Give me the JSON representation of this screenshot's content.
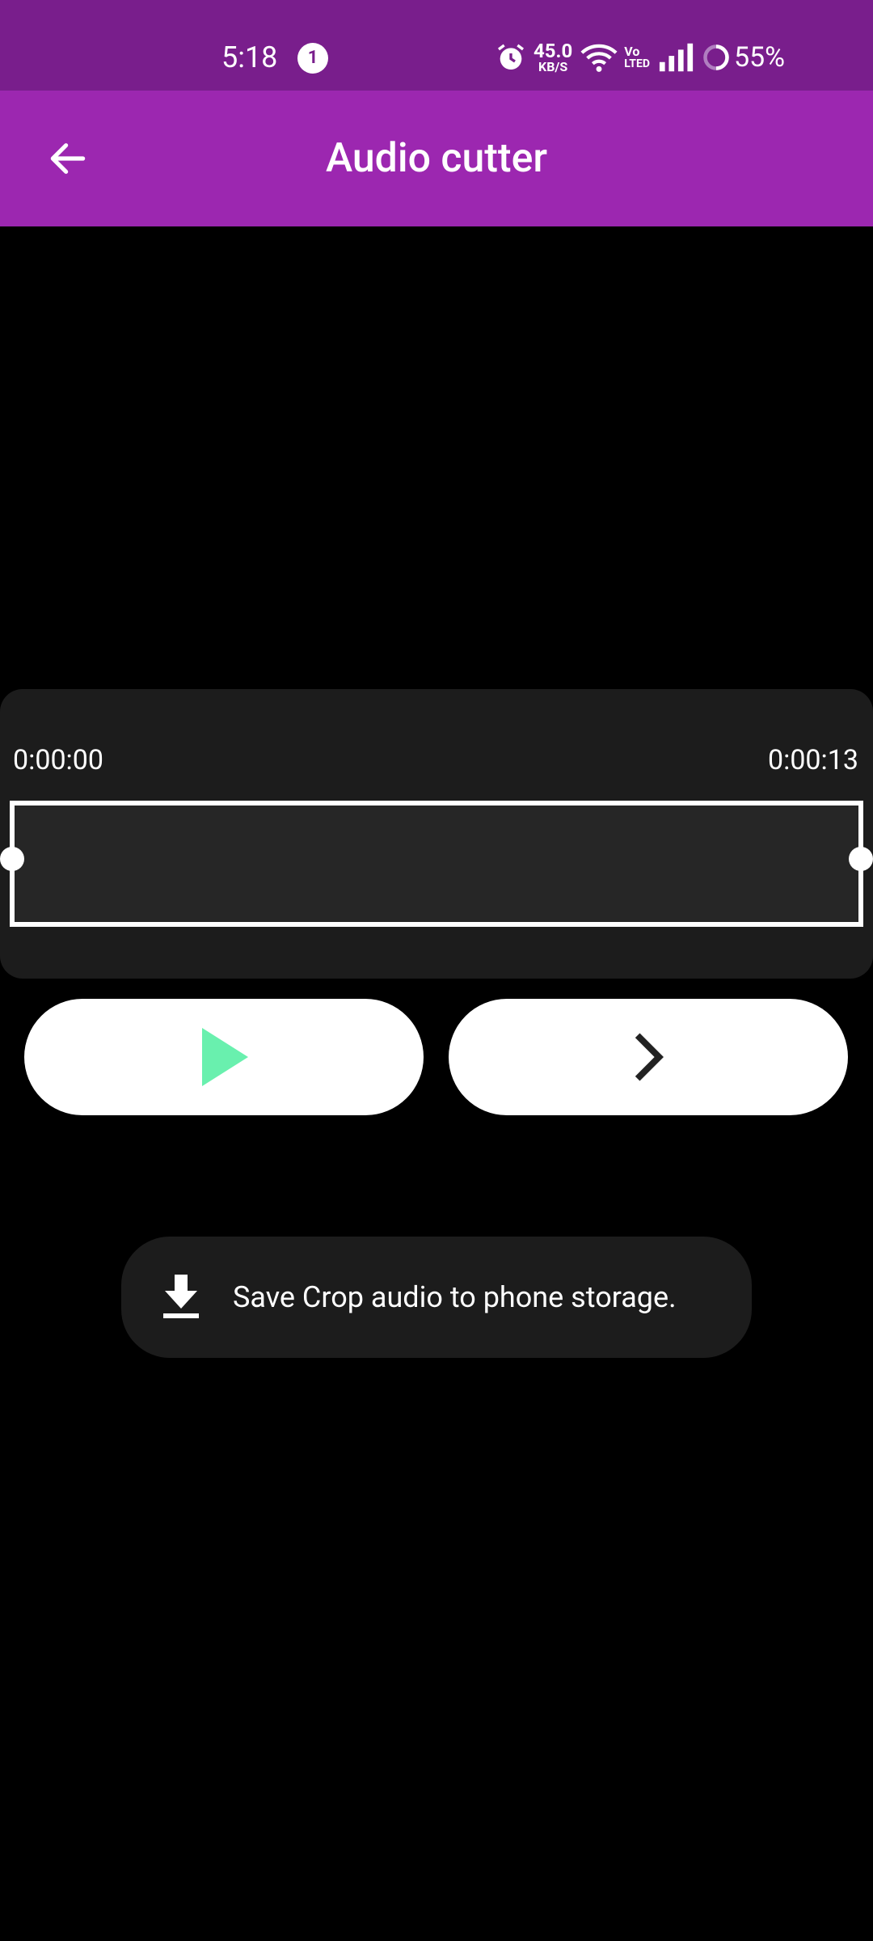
{
  "status_bar": {
    "time": "5:18",
    "notification_count": "1",
    "net_speed_value": "45.0",
    "net_speed_unit": "KB/S",
    "volte_top": "Vo",
    "volte_bottom": "LTED",
    "battery_percent": "55%"
  },
  "app_bar": {
    "title": "Audio cutter",
    "back_icon": "arrow-left-icon"
  },
  "cutter": {
    "start_time": "0:00:00",
    "end_time": "0:00:13"
  },
  "controls": {
    "play_icon": "play-icon",
    "next_icon": "chevron-right-icon",
    "play_color": "#69f0ae"
  },
  "save": {
    "icon": "download-icon",
    "label": "Save Crop audio to phone storage."
  },
  "colors": {
    "status_bar": "#791e8c",
    "app_bar": "#9c27b0",
    "background": "#000000",
    "panel": "#1c1c1c"
  }
}
